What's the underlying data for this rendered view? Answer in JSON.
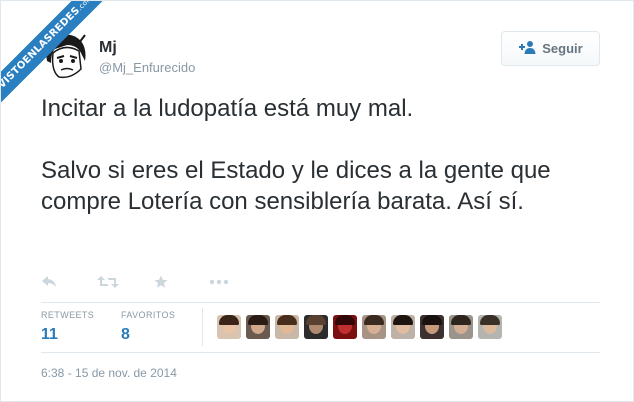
{
  "watermark": {
    "line1": "VISTOENLASREDES",
    "line2": ".com"
  },
  "author": {
    "name": "Mj",
    "handle": "@Mj_Enfurecido"
  },
  "follow_button": {
    "label": "Seguir",
    "icon": "add-user-icon"
  },
  "tweet": {
    "paragraphs": [
      "Incitar a la ludopatía está muy mal.",
      "Salvo si eres el Estado y le dices a la gente que compre Lotería con sensiblería barata. Así sí."
    ]
  },
  "actions": [
    {
      "name": "reply-icon"
    },
    {
      "name": "retweet-icon"
    },
    {
      "name": "favorite-icon"
    },
    {
      "name": "more-icon"
    }
  ],
  "stats": {
    "retweets": {
      "label": "RETWEETS",
      "value": "11"
    },
    "favorites": {
      "label": "FAVORITOS",
      "value": "8"
    }
  },
  "timestamp": "6:38 - 15 de nov. de 2014",
  "colors": {
    "accent": "#2b7bb9",
    "muted": "#8899a6",
    "ribbon": "#2a7fc1"
  }
}
